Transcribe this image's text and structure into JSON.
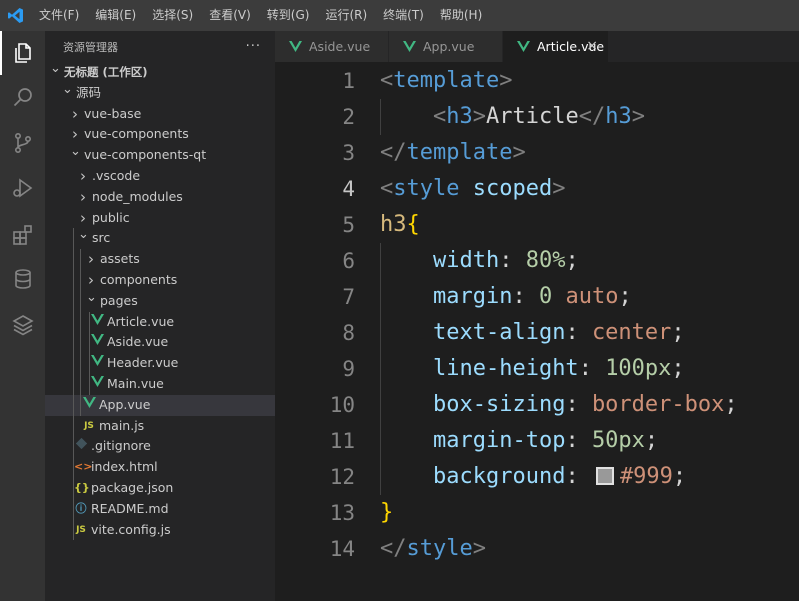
{
  "menu": [
    "文件(F)",
    "编辑(E)",
    "选择(S)",
    "查看(V)",
    "转到(G)",
    "运行(R)",
    "终端(T)",
    "帮助(H)"
  ],
  "activity": [
    "explorer-icon",
    "search-icon",
    "source-control-icon",
    "run-debug-icon",
    "extensions-icon",
    "database-icon",
    "layers-icon"
  ],
  "sidebar": {
    "title": "资源管理器",
    "more": "···",
    "tree": [
      {
        "label": "无标题 (工作区)",
        "chevron": "down",
        "icon": "",
        "bold": true
      },
      {
        "label": "源码",
        "chevron": "down",
        "icon": ""
      },
      {
        "label": "vue-base",
        "chevron": "right",
        "icon": ""
      },
      {
        "label": "vue-components",
        "chevron": "right",
        "icon": ""
      },
      {
        "label": "vue-components-qt",
        "chevron": "down",
        "icon": ""
      },
      {
        "label": ".vscode",
        "chevron": "right",
        "icon": ""
      },
      {
        "label": "node_modules",
        "chevron": "right",
        "icon": ""
      },
      {
        "label": "public",
        "chevron": "right",
        "icon": ""
      },
      {
        "label": "src",
        "chevron": "down",
        "icon": ""
      },
      {
        "label": "assets",
        "chevron": "right",
        "icon": ""
      },
      {
        "label": "components",
        "chevron": "right",
        "icon": ""
      },
      {
        "label": "pages",
        "chevron": "down",
        "icon": ""
      },
      {
        "label": "Article.vue",
        "chevron": "",
        "icon": "vue"
      },
      {
        "label": "Aside.vue",
        "chevron": "",
        "icon": "vue"
      },
      {
        "label": "Header.vue",
        "chevron": "",
        "icon": "vue"
      },
      {
        "label": "Main.vue",
        "chevron": "",
        "icon": "vue"
      },
      {
        "label": "App.vue",
        "chevron": "",
        "icon": "vue",
        "selected": true
      },
      {
        "label": "main.js",
        "chevron": "",
        "icon": "js",
        "icon_text": "JS"
      },
      {
        "label": ".gitignore",
        "chevron": "",
        "icon": "git"
      },
      {
        "label": "index.html",
        "chevron": "",
        "icon": "html",
        "icon_text": "<>"
      },
      {
        "label": "package.json",
        "chevron": "",
        "icon": "json",
        "icon_text": "{}"
      },
      {
        "label": "README.md",
        "chevron": "",
        "icon": "info",
        "icon_text": "ⓘ"
      },
      {
        "label": "vite.config.js",
        "chevron": "",
        "icon": "js",
        "icon_text": "JS"
      }
    ]
  },
  "tabs": [
    {
      "label": "Aside.vue",
      "active": false
    },
    {
      "label": "App.vue",
      "active": false
    },
    {
      "label": "Article.vue",
      "active": true,
      "close": "×"
    }
  ],
  "editor": {
    "current_line": 4,
    "lines": [
      [
        {
          "t": "<",
          "c": "br"
        },
        {
          "t": "template",
          "c": "tag"
        },
        {
          "t": ">",
          "c": "br"
        }
      ],
      [
        {
          "t": "    ",
          "c": "txt"
        },
        {
          "t": "<",
          "c": "br"
        },
        {
          "t": "h3",
          "c": "tag"
        },
        {
          "t": ">",
          "c": "br"
        },
        {
          "t": "Article",
          "c": "txt"
        },
        {
          "t": "</",
          "c": "br"
        },
        {
          "t": "h3",
          "c": "tag"
        },
        {
          "t": ">",
          "c": "br"
        }
      ],
      [
        {
          "t": "</",
          "c": "br"
        },
        {
          "t": "template",
          "c": "tag"
        },
        {
          "t": ">",
          "c": "br"
        }
      ],
      [
        {
          "t": "<",
          "c": "br"
        },
        {
          "t": "style",
          "c": "tag"
        },
        {
          "t": " ",
          "c": "txt"
        },
        {
          "t": "scoped",
          "c": "attr"
        },
        {
          "t": ">",
          "c": "br"
        }
      ],
      [
        {
          "t": "h3",
          "c": "sel"
        },
        {
          "t": "{",
          "c": "brace"
        }
      ],
      [
        {
          "t": "    ",
          "c": "txt"
        },
        {
          "t": "width",
          "c": "attr"
        },
        {
          "t": ": ",
          "c": "txt"
        },
        {
          "t": "80%",
          "c": "num"
        },
        {
          "t": ";",
          "c": "txt"
        }
      ],
      [
        {
          "t": "    ",
          "c": "txt"
        },
        {
          "t": "margin",
          "c": "attr"
        },
        {
          "t": ": ",
          "c": "txt"
        },
        {
          "t": "0",
          "c": "num"
        },
        {
          "t": " ",
          "c": "txt"
        },
        {
          "t": "auto",
          "c": "val"
        },
        {
          "t": ";",
          "c": "txt"
        }
      ],
      [
        {
          "t": "    ",
          "c": "txt"
        },
        {
          "t": "text-align",
          "c": "attr"
        },
        {
          "t": ": ",
          "c": "txt"
        },
        {
          "t": "center",
          "c": "val"
        },
        {
          "t": ";",
          "c": "txt"
        }
      ],
      [
        {
          "t": "    ",
          "c": "txt"
        },
        {
          "t": "line-height",
          "c": "attr"
        },
        {
          "t": ": ",
          "c": "txt"
        },
        {
          "t": "100px",
          "c": "num"
        },
        {
          "t": ";",
          "c": "txt"
        }
      ],
      [
        {
          "t": "    ",
          "c": "txt"
        },
        {
          "t": "box-sizing",
          "c": "attr"
        },
        {
          "t": ": ",
          "c": "txt"
        },
        {
          "t": "border-box",
          "c": "val"
        },
        {
          "t": ";",
          "c": "txt"
        }
      ],
      [
        {
          "t": "    ",
          "c": "txt"
        },
        {
          "t": "margin-top",
          "c": "attr"
        },
        {
          "t": ": ",
          "c": "txt"
        },
        {
          "t": "50px",
          "c": "num"
        },
        {
          "t": ";",
          "c": "txt"
        }
      ],
      [
        {
          "t": "    ",
          "c": "txt"
        },
        {
          "t": "background",
          "c": "attr"
        },
        {
          "t": ": ",
          "c": "txt"
        },
        {
          "t": "",
          "c": "swatch"
        },
        {
          "t": "#999",
          "c": "val"
        },
        {
          "t": ";",
          "c": "txt"
        }
      ],
      [
        {
          "t": "}",
          "c": "brace"
        }
      ],
      [
        {
          "t": "</",
          "c": "br"
        },
        {
          "t": "style",
          "c": "tag"
        },
        {
          "t": ">",
          "c": "br"
        }
      ]
    ]
  },
  "colors": {
    "vue_green": "#41b883",
    "js_yellow": "#cbcb41",
    "html_orange": "#e37933",
    "info_blue": "#519aba",
    "git_gray": "#41535b",
    "swatch": "#999999"
  }
}
